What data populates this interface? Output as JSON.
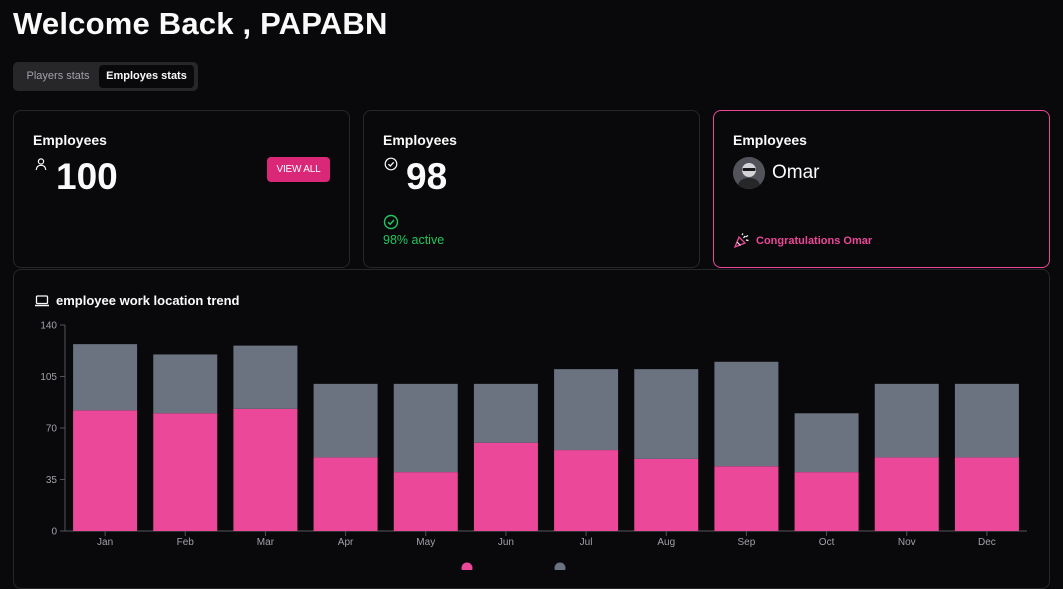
{
  "header": {
    "title": "Welcome Back , PAPABN"
  },
  "tabs": [
    {
      "label": "Players stats",
      "active": false
    },
    {
      "label": "Employes stats",
      "active": true
    }
  ],
  "cards": {
    "total": {
      "label": "Employees",
      "value": "100",
      "button": "VIEW ALL",
      "icon": "user-icon"
    },
    "active": {
      "label": "Employees",
      "value": "98",
      "status": "98% active",
      "icon": "check-circle-icon"
    },
    "highlight": {
      "label": "Employees",
      "name": "Omar",
      "message": "Congratulations Omar",
      "icon": "party-popper-icon"
    }
  },
  "colors": {
    "accent": "#ec4899",
    "button": "#db2777",
    "secondary": "#6b7280",
    "success": "#22c55e"
  },
  "chart_data": {
    "type": "bar",
    "stacked": true,
    "title": "employee work location trend",
    "categories": [
      "Jan",
      "Feb",
      "Mar",
      "Apr",
      "May",
      "Jun",
      "Jul",
      "Aug",
      "Sep",
      "Oct",
      "Nov",
      "Dec"
    ],
    "series": [
      {
        "values": [
          82,
          80,
          83,
          50,
          40,
          60,
          55,
          49,
          44,
          40,
          50,
          50
        ],
        "color": "#ec4899"
      },
      {
        "values": [
          45,
          40,
          43,
          50,
          60,
          40,
          55,
          61,
          71,
          40,
          50,
          50
        ],
        "color": "#6b7280"
      }
    ],
    "yticks": [
      "0",
      "35",
      "70",
      "105",
      "140"
    ],
    "ylim": [
      0,
      140
    ],
    "grid": false
  }
}
